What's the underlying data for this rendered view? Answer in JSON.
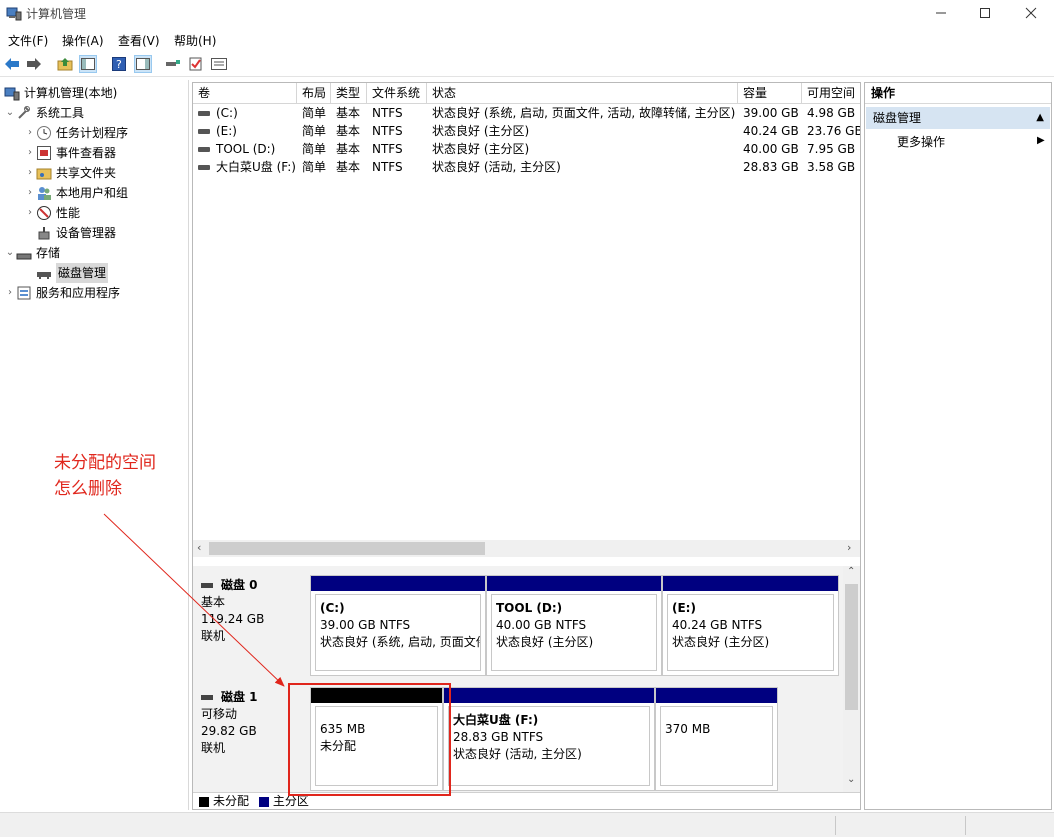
{
  "window": {
    "title": "计算机管理",
    "controls": [
      "minimize-icon",
      "maximize-icon",
      "close-icon"
    ]
  },
  "menu": [
    "文件(F)",
    "操作(A)",
    "查看(V)",
    "帮助(H)"
  ],
  "toolbar": [
    "back-arrow-icon",
    "forward-arrow-icon",
    "up-folder-icon",
    "show-hide-tree-icon",
    "help-icon",
    "show-hide-action-pane-icon",
    "connect-icon",
    "check-icon",
    "properties-icon"
  ],
  "tree": {
    "root": "计算机管理(本地)",
    "system_tools": "系统工具",
    "task_scheduler": "任务计划程序",
    "event_viewer": "事件查看器",
    "shared_folders": "共享文件夹",
    "local_users": "本地用户和组",
    "performance": "性能",
    "device_manager": "设备管理器",
    "storage": "存储",
    "disk_management": "磁盘管理",
    "services": "服务和应用程序"
  },
  "volumes": {
    "columns": [
      "卷",
      "布局",
      "类型",
      "文件系统",
      "状态",
      "容量",
      "可用空间"
    ],
    "rows": [
      [
        "(C:)",
        "简单",
        "基本",
        "NTFS",
        "状态良好 (系统, 启动, 页面文件, 活动, 故障转储, 主分区)",
        "39.00 GB",
        "4.98 GB"
      ],
      [
        "(E:)",
        "简单",
        "基本",
        "NTFS",
        "状态良好 (主分区)",
        "40.24 GB",
        "23.76 GB"
      ],
      [
        "TOOL (D:)",
        "简单",
        "基本",
        "NTFS",
        "状态良好 (主分区)",
        "40.00 GB",
        "7.95 GB"
      ],
      [
        "大白菜U盘 (F:)",
        "简单",
        "基本",
        "NTFS",
        "状态良好 (活动, 主分区)",
        "28.83 GB",
        "3.58 GB"
      ]
    ]
  },
  "disks": {
    "disk0": {
      "name": "磁盘 0",
      "type": "基本",
      "size": "119.24 GB",
      "state": "联机",
      "partitions": [
        {
          "name": "(C:)",
          "size": "39.00 GB NTFS",
          "status": "状态良好 (系统, 启动, 页面文件"
        },
        {
          "name": "TOOL  (D:)",
          "size": "40.00 GB NTFS",
          "status": "状态良好 (主分区)"
        },
        {
          "name": "(E:)",
          "size": "40.24 GB NTFS",
          "status": "状态良好 (主分区)"
        }
      ]
    },
    "disk1": {
      "name": "磁盘 1",
      "type": "可移动",
      "size": "29.82 GB",
      "state": "联机",
      "partitions": [
        {
          "size": "635 MB",
          "status": "未分配"
        },
        {
          "name": "大白菜U盘  (F:)",
          "size": "28.83 GB NTFS",
          "status": "状态良好 (活动, 主分区)"
        },
        {
          "size": "370 MB"
        }
      ]
    }
  },
  "legend": {
    "unallocated": "未分配",
    "primary": "主分区"
  },
  "actions": {
    "header": "操作",
    "group": "磁盘管理",
    "more": "更多操作"
  },
  "annotation": {
    "line1": "未分配的空间",
    "line2": "怎么删除"
  },
  "colors": {
    "primary_partition": "#000080",
    "unallocated": "#000000",
    "annotation": "#e0261c",
    "action_group_bg": "#d6e4f2"
  }
}
